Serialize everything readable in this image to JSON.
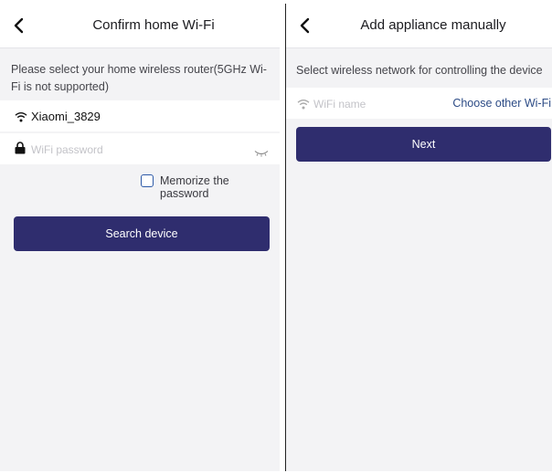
{
  "left_screen": {
    "title": "Confirm home Wi-Fi",
    "instruction": "Please select your home wireless router(5GHz Wi-Fi is not supported)",
    "wifi_name": "Xiaomi_3829",
    "password_placeholder": "WiFi password",
    "memorize_label": "Memorize the password",
    "memorize_checked": false,
    "search_button_label": "Search device",
    "icons": [
      "chevron-left-icon",
      "wifi-icon",
      "lock-icon",
      "eye-closed-icon"
    ]
  },
  "right_screen": {
    "title": "Add appliance manually",
    "instruction": "Select wireless network for controlling the device",
    "wifi_placeholder": "WiFi name",
    "choose_other_label": "Choose other Wi-Fi",
    "next_button_label": "Next",
    "icons": [
      "chevron-left-icon",
      "wifi-icon"
    ]
  },
  "colors": {
    "primary_button": "#2f2d6e",
    "link": "#2d4c86",
    "screen_background": "#f3f3f5"
  }
}
